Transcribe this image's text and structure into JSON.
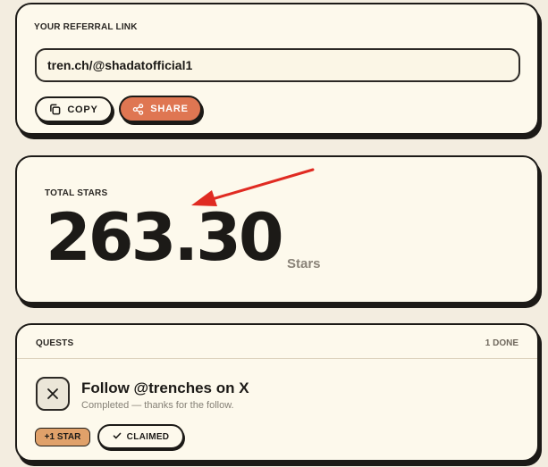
{
  "referral": {
    "label": "YOUR REFERRAL LINK",
    "link": "tren.ch/@shadatofficial1",
    "copy_label": "COPY",
    "share_label": "SHARE"
  },
  "stars": {
    "label": "TOTAL STARS",
    "value": "263.30",
    "unit": "Stars"
  },
  "quests": {
    "label": "QUESTS",
    "done_count": "1 DONE",
    "items": [
      {
        "icon": "x-logo-icon",
        "title": "Follow @trenches on X",
        "description": "Completed — thanks for the follow.",
        "reward": "+1 STAR",
        "status": "CLAIMED"
      }
    ]
  },
  "colors": {
    "background": "#f3ede0",
    "card": "#fdf9ec",
    "accent": "#df7652",
    "reward": "#e0a16a",
    "annotation_arrow": "#e02b22"
  }
}
